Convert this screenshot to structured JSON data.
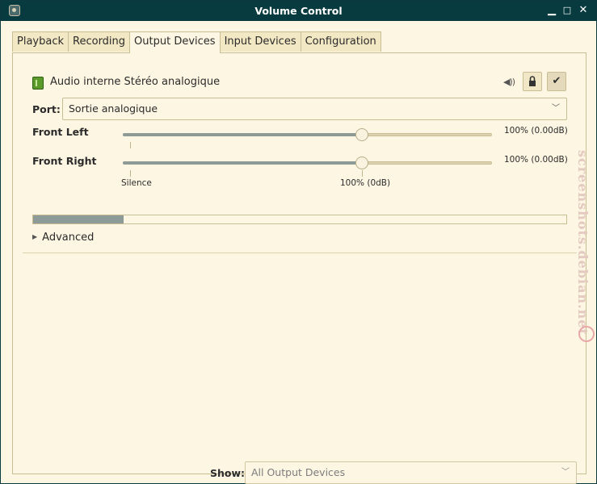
{
  "window": {
    "title": "Volume Control",
    "controls": {
      "minimize": "▁",
      "maximize": "□",
      "close": "✕"
    }
  },
  "tabs": [
    {
      "label": "Playback",
      "active": false
    },
    {
      "label": "Recording",
      "active": false
    },
    {
      "label": "Output Devices",
      "active": true
    },
    {
      "label": "Input Devices",
      "active": false
    },
    {
      "label": "Configuration",
      "active": false
    }
  ],
  "device": {
    "name": "Audio interne Stéréo analogique",
    "icon": "sound-card-icon",
    "lock_button": "lock-icon",
    "default_button": "✔",
    "port_label": "Port:",
    "port_value": "Sortie analogique",
    "channels": [
      {
        "name": "Front Left",
        "value_label": "100% (0.00dB)",
        "level_percent": 100
      },
      {
        "name": "Front Right",
        "value_label": "100% (0.00dB)",
        "level_percent": 100
      }
    ],
    "scale_marks": {
      "silence": "Silence",
      "unity": "100% (0dB)"
    },
    "peak_meter_fraction": 0.17,
    "advanced_label": "Advanced"
  },
  "footer": {
    "show_label": "Show:",
    "show_value": "All Output Devices"
  },
  "watermark": {
    "text": "screenshots.debian.net"
  },
  "colors": {
    "titlebar": "#073b3f",
    "background": "#fdf6e3",
    "slider_fill": "#8e9a96",
    "border": "#c9bd94"
  }
}
